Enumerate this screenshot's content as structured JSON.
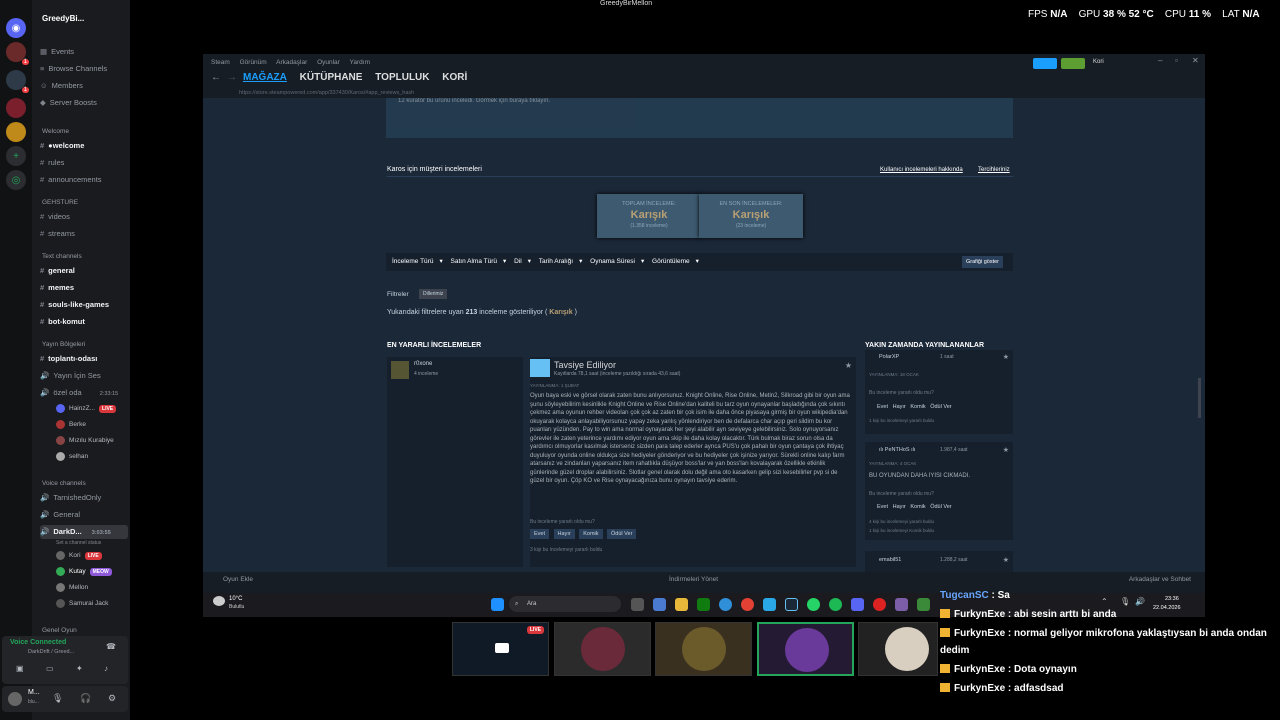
{
  "window_title": "GreedyBirMellon",
  "perf": {
    "fps_label": "FPS",
    "fps": "N/A",
    "gpu_label": "GPU",
    "gpu": "38 %",
    "gpu_temp": "52 °C",
    "cpu_label": "CPU",
    "cpu": "11 %",
    "lat_label": "LAT",
    "lat": "N/A"
  },
  "discord": {
    "server_name": "GreedyBi...",
    "channels_top": [
      "Events",
      "Browse Channels",
      "Members",
      "Server Boosts"
    ],
    "cat_welcome": "Welcome",
    "welcome_channels": [
      "●welcome",
      "rules",
      "announcements"
    ],
    "cat_gehsture": "GEHSTURE",
    "gehsture_channels": [
      "videos",
      "streams"
    ],
    "cat_text": "Text channels",
    "text_channels": [
      "general",
      "memes",
      "souls-like-games",
      "bot-komut"
    ],
    "cat_yayin": "Yayın Bölgeleri",
    "yayin_channels": [
      "toplantı-odası",
      "Yayın İçin Ses"
    ],
    "ozel_oda": "özel oda",
    "ozel_time": "2:33:15",
    "ozel_users": [
      "HainzZ...",
      "Berke",
      "Mızılu Kurabiye",
      "selhan"
    ],
    "live": "LIVE",
    "cat_voice": "Voice channels",
    "voice_channels": [
      "TarnishedOnly",
      "General"
    ],
    "darkd": "DarkD...",
    "darkd_time": "3:03:55",
    "darkd_status": "Set a channel status",
    "darkd_users": [
      "Kori",
      "Kutay",
      "Mellon",
      "Samurai Jack"
    ],
    "meow": "MEOW",
    "cat_genel": "Genel Oyun",
    "voice_connected": "Voice Connected",
    "voice_sub": "DarkDrift / Greed...",
    "user_short": "M...",
    "user_sub": "blu..."
  },
  "steam": {
    "menu": [
      "Steam",
      "Görünüm",
      "Arkadaşlar",
      "Oyunlar",
      "Yardım"
    ],
    "nav": [
      "MAĞAZA",
      "KÜTÜPHANE",
      "TOPLULUK",
      "KORİ"
    ],
    "url": "https://store.steampowered.com/app/337430/Karos/#app_reviews_hash",
    "user": "Kori",
    "strip_text": "12 küratör bu ürünü inceledi. Görmek için buraya tıklayın.",
    "review_title": "Karos için müşteri incelemeleri",
    "link1": "Kullanıcı incelemeleri hakkında",
    "link2": "Tercihleriniz",
    "total_label": "TOPLAM İNCELEME:",
    "total_value": "Karışık",
    "total_count": "(1.358 inceleme)",
    "recent_label": "EN SON İNCELEMELER:",
    "recent_value": "Karışık",
    "recent_count": "(23 inceleme)",
    "filters": [
      "İnceleme Türü",
      "Satın Alma Türü",
      "Dil",
      "Tarih Aralığı",
      "Oynama Süresi",
      "Görüntüleme"
    ],
    "graph_btn": "Grafiği göster",
    "filtreler": "Filtreler",
    "filter_chip": "Dillerimiz",
    "showing_pre": "Yukarıdaki filtrelere uyan",
    "showing_num": "213",
    "showing_post": "inceleme gösteriliyor (",
    "showing_mixed": "Karışık",
    "showing_close": ")",
    "helpful_header": "EN YARARLI İNCELEMELER",
    "recent_header": "YAKIN ZAMANDA YAYINLANANLAR",
    "reviewer": "r0xone",
    "reviewer_sub": "4 inceleme",
    "recommended": "Tavsiye Ediliyor",
    "hours": "Kayıtlarda 78,1 saat (inceleme yazıldığı sırada 43,6 saat)",
    "posted": "YAYINLANMA: 1 ŞUBAT",
    "review_body": "Oyun baya eski ve görsel olarak zaten bunu anlıyorsunuz. Knight Online, Rise Online, Metin2, Silkroad gibi bir oyun ama şunu söyleyebilirim kesinlikle Knight Online ve Rise Online'dan kaliteli bu tarz oyun oynayanlar başladığında çok sıkıntı çekmez ama oyunun rehber videoları çok çok az zaten bir çok isim ile daha önce piyasaya girmiş bir oyun wikipedia'dan okuyarak kolayca anlayabiliyorsunuz yapay zeka yanlış yönlendiriyor ben de defalarca char açıp geri sildim bu kor puanları yüzünden. Pay to win ama normal oynayarak her şeyi alabilir ayrı seviyeye gelebilirsiniz. Solo oynuyorsanız görevler ile zaten yeterince yardımı ediyor oyun ama skip ile daha kolay olacaktır. Türk bulmak biraz sorun olsa da yardımcı olmuyorlar kasılmak isterseniz sizden para talep ederler ayrıca PUS'u çok pahalı bir oyun çantaya çok ihtiyaç duyuluyor oyunda online oldukça size hediyeler gönderiyor ve bu hediyeler çok işinize yarıyor. Sürekli online kalıp farm atarsanız ve zindanları yaparsanız item rahatlıkla düşüyor boss'lar ve yan boss'ları kovalayarak özellikle etkinlik günlerinde güzel droplar alabilirsiniz. Slotlar genel olarak dolu değil ama oto kasarken gelip sizi kesebilirler pvp si de güzel bir oyun. Çöp KO ve Rise oynayacağınıza bunu oynayın tavsiye ederim.",
    "helpful_q": "Bu inceleme yararlı oldu mu?",
    "btn_yes": "Evet",
    "btn_no": "Hayır",
    "btn_funny": "Komik",
    "btn_award": "Ödül Ver",
    "helpful_count": "3 kişi bu incelemeyi yararlı buldu",
    "side1_name": "PolarXP",
    "side1_hours": "1 saat",
    "side1_posted": "YAYINLANMA: 18 OCAK",
    "side1_q": "Bu inceleme yararlı oldu mu?",
    "side1_count": "1 kişi bu incelemeyi yararlı buldu",
    "side2_name": "ılı PeNTHoS ılı",
    "side2_hours": "1.987,4 saat",
    "side2_posted": "YAYINLANMA: 4 OCAK",
    "side2_text": "BU OYUNDAN DAHA IYISI CIKMADI.",
    "side2_q": "Bu inceleme yararlı oldu mu?",
    "side2_count": "4 kişi bu incelemeyi yararlı buldu",
    "side2_count2": "1 kişi bu incelemeyi Komik buldu",
    "side3_name": "emabil51",
    "side3_hours": "1.288,2 saat",
    "add_game": "Oyun Ekle",
    "downloads": "İndirmeleri Yönet",
    "friends": "Arkadaşlar ve Sohbet"
  },
  "taskbar": {
    "weather_temp": "10°C",
    "weather_desc": "Bulutlu",
    "search": "Ara",
    "time": "23:36",
    "date": "22.04.2026"
  },
  "chat": [
    {
      "name": "TugcanSC",
      "msg": "Sa"
    },
    {
      "name": "FurkynExe",
      "msg": "abi sesin arttı bi anda"
    },
    {
      "name": "FurkynExe",
      "msg": "normal geliyor mikrofona yaklaştıysan bi anda ondan"
    },
    {
      "name": "",
      "msg": "dedim"
    },
    {
      "name": "FurkynExe",
      "msg": "Dota oynayın"
    },
    {
      "name": "FurkynExe",
      "msg": "adfasdsad"
    }
  ]
}
